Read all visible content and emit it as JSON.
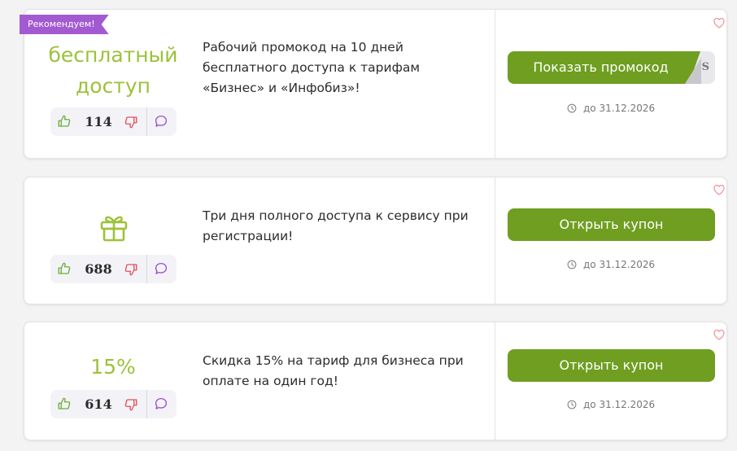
{
  "coupons": [
    {
      "badge": "Рекомендуем!",
      "offer_line1": "бесплатный",
      "offer_line2": "доступ",
      "likes": "114",
      "description_line1": "Рабочий промокод на 10 дней",
      "description_line2": "бесплатного доступа к тарифам",
      "description_line3": "«Бизнес» и «Инфобиз»!",
      "button_label": "Показать промокод",
      "code_peek": "S",
      "expiry": "до 31.12.2026",
      "icon": "thumbs-up-icon"
    },
    {
      "offer_icon": "gift-icon",
      "likes": "688",
      "description_line1": "Три дня полного доступа к сервису при",
      "description_line2": "регистрации!",
      "button_label": "Открыть купон",
      "expiry": "до 31.12.2026"
    },
    {
      "offer_value": "15%",
      "likes": "614",
      "description_line1": "Скидка 15% на тариф для бизнеса при",
      "description_line2": "оплате на один год!",
      "button_label": "Открыть купон",
      "expiry": "до 31.12.2026"
    }
  ],
  "colors": {
    "accent_green": "#6f9e21",
    "offer_green": "#9cc23a",
    "badge_purple": "#a35ad1",
    "dislike_red": "#e0505a",
    "comment_purple": "#9b4fd0",
    "heart_pink": "#ef8a97"
  }
}
